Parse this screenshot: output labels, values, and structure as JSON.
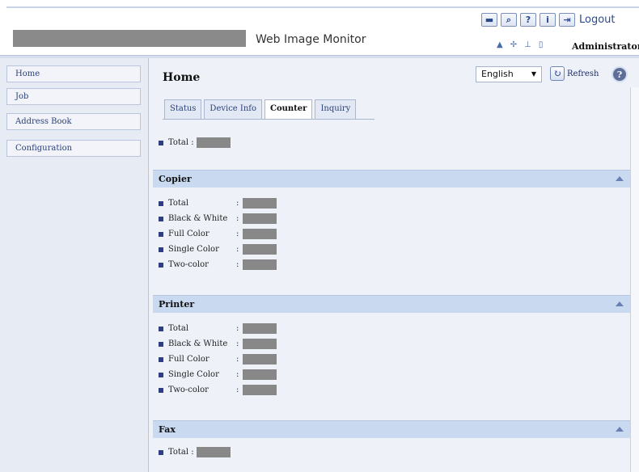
{
  "header": {
    "app_title": "Web Image Monitor",
    "logout_label": "Logout",
    "user_label": "Administrator",
    "toolbar_icons": [
      "keyboard-icon",
      "search-icon",
      "help-icon",
      "info-icon",
      "logout-icon"
    ]
  },
  "sidebar": {
    "items": [
      {
        "label": "Home"
      },
      {
        "label": "Job"
      },
      {
        "label": "Address Book"
      },
      {
        "label": "Configuration"
      }
    ]
  },
  "main": {
    "title": "Home",
    "language": "English",
    "refresh_label": "Refresh",
    "tabs": [
      {
        "label": "Status",
        "active": false
      },
      {
        "label": "Device Info",
        "active": false
      },
      {
        "label": "Counter",
        "active": true
      },
      {
        "label": "Inquiry",
        "active": false
      }
    ],
    "total_label": "Total :",
    "sections": [
      {
        "title": "Copier",
        "rows": [
          "Total",
          "Black & White",
          "Full Color",
          "Single Color",
          "Two-color"
        ]
      },
      {
        "title": "Printer",
        "rows": [
          "Total",
          "Black & White",
          "Full Color",
          "Single Color",
          "Two-color"
        ]
      },
      {
        "title": "Fax",
        "total_label": "Total :"
      }
    ]
  },
  "colors": {
    "section_bar": "#c8d9f0",
    "sidebar_bg": "#e6ebf4",
    "bullet": "#2d3f82",
    "redaction": "#888888"
  }
}
